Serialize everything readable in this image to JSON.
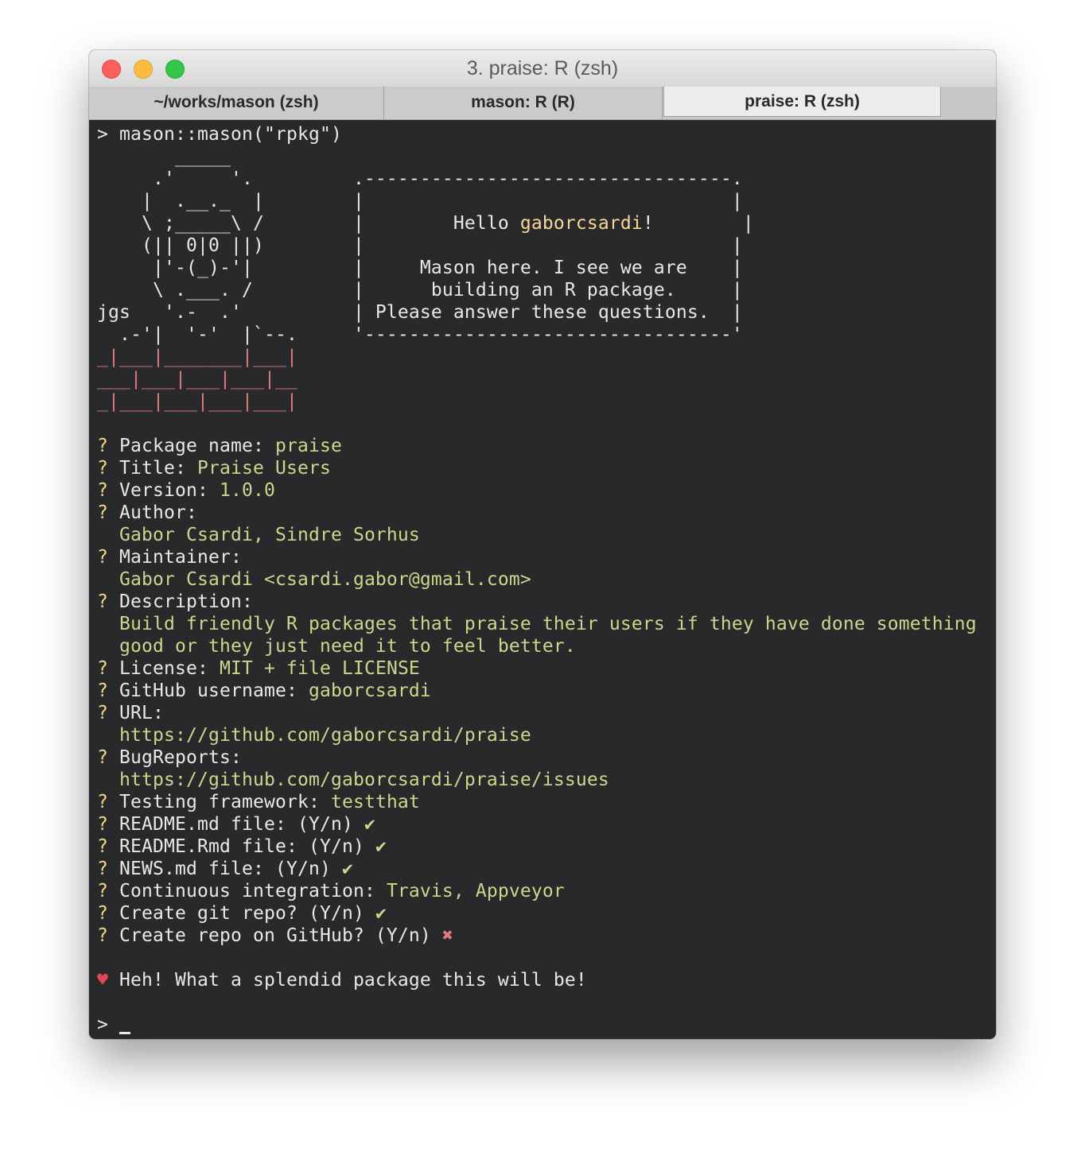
{
  "window": {
    "title": "3. praise: R (zsh)"
  },
  "tabs": [
    {
      "label": "~/works/mason (zsh)",
      "active": false
    },
    {
      "label": "mason: R (R)",
      "active": false
    },
    {
      "label": "praise: R (zsh)",
      "active": true
    }
  ],
  "colors": {
    "background": "#27292b",
    "text": "#e8e8e8",
    "answer": "#c9d88a",
    "question_mark": "#f5d77f",
    "brick": "#e2787a",
    "heart": "#e5454f"
  },
  "terminal": {
    "command_line": "> mason::mason(\"rpkg\")",
    "art": {
      "mason_lines": [
        "       _____",
        "     .'     '.",
        "    |  .__._  |",
        "    \\ ;_____\\ /",
        "    (|| 0|0 ||)",
        "     |'-(_)-'|",
        "     \\ .___. /",
        "jgs   '.-  .'",
        "  .-'|  '-'  |`--."
      ],
      "brick_lines": [
        "_|___|_______|___|",
        "___|___|___|___|__",
        "_|___|___|___|___|"
      ]
    },
    "box": {
      "top_border": ".---------------------------------.",
      "blank": "|                                 |",
      "greeting_prefix": "|        Hello ",
      "greeting_name": "gaborcsardi",
      "greeting_suffix": "!        |",
      "line_1": "|     Mason here. I see we are    |",
      "line_2": "|      building an R package.     |",
      "line_3": "| Please answer these questions.  |",
      "bottom_border": "'---------------------------------'"
    },
    "qa": [
      {
        "question": "Package name: ",
        "answer": "praise"
      },
      {
        "question": "Title: ",
        "answer": "Praise Users"
      },
      {
        "question": "Version: ",
        "answer": "1.0.0"
      },
      {
        "question": "Author:",
        "answer_lines": [
          "Gabor Csardi, Sindre Sorhus"
        ]
      },
      {
        "question": "Maintainer:",
        "answer_lines": [
          "Gabor Csardi <csardi.gabor@gmail.com>"
        ]
      },
      {
        "question": "Description:",
        "answer_lines": [
          "Build friendly R packages that praise their users if they have done something",
          "good or they just need it to feel better."
        ]
      },
      {
        "question": "License: ",
        "answer": "MIT + file LICENSE"
      },
      {
        "question": "GitHub username: ",
        "answer": "gaborcsardi"
      },
      {
        "question": "URL:",
        "answer_lines": [
          "https://github.com/gaborcsardi/praise"
        ]
      },
      {
        "question": "BugReports:",
        "answer_lines": [
          "https://github.com/gaborcsardi/praise/issues"
        ]
      },
      {
        "question": "Testing framework: ",
        "answer": "testthat"
      },
      {
        "question": "README.md file: (Y/n) ",
        "mark": "✔"
      },
      {
        "question": "README.Rmd file: (Y/n) ",
        "mark": "✔"
      },
      {
        "question": "NEWS.md file: (Y/n) ",
        "mark": "✔"
      },
      {
        "question": "Continuous integration: ",
        "answer": "Travis, Appveyor"
      },
      {
        "question": "Create git repo? (Y/n) ",
        "mark": "✔"
      },
      {
        "question": "Create repo on GitHub? (Y/n) ",
        "mark": "✖"
      }
    ],
    "question_marker": "? ",
    "heart": "♥",
    "final_message": " Heh! What a splendid package this will be!",
    "prompt": "> "
  }
}
